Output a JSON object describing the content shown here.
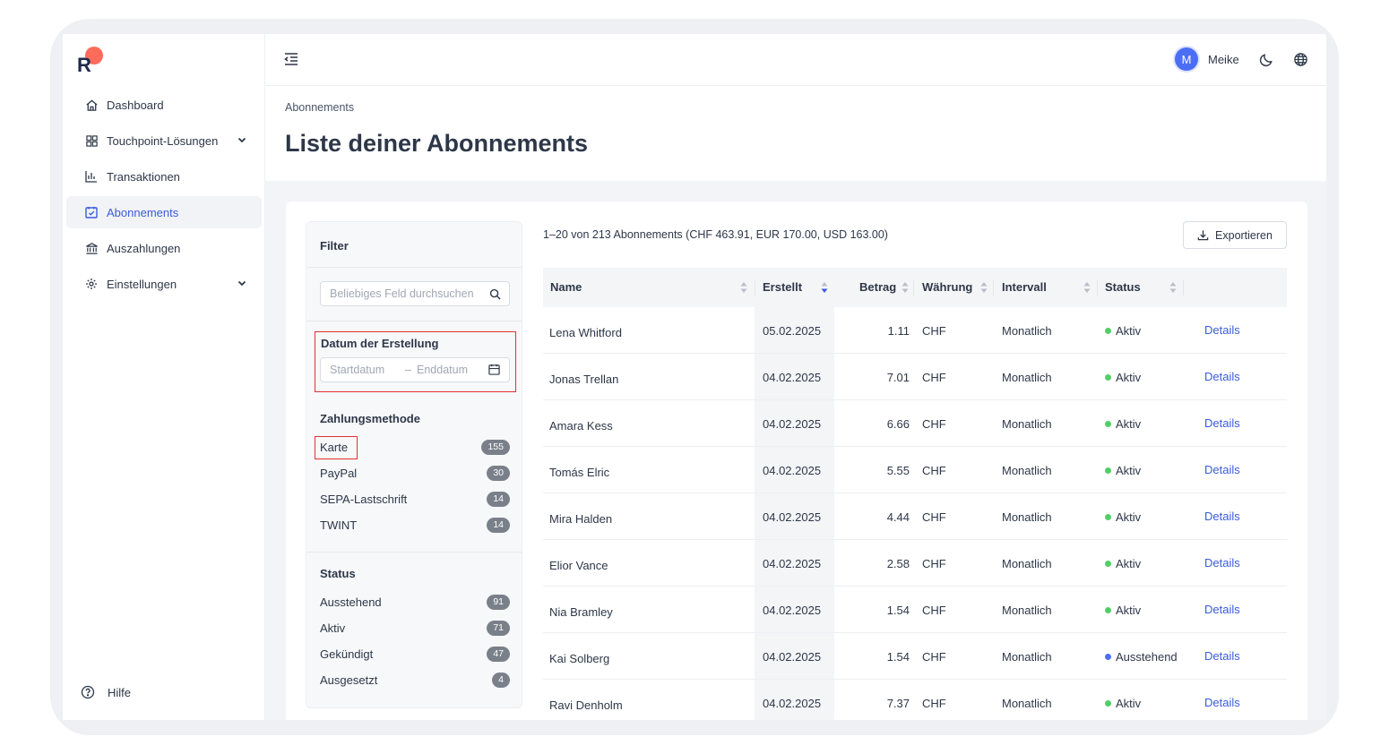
{
  "sidebar": {
    "items": [
      {
        "label": "Dashboard",
        "icon": "home-icon"
      },
      {
        "label": "Touchpoint-Lösungen",
        "icon": "grid-icon"
      },
      {
        "label": "Transaktionen",
        "icon": "bar-chart-icon"
      },
      {
        "label": "Abonnements",
        "icon": "calendar-check-icon"
      },
      {
        "label": "Auszahlungen",
        "icon": "bank-icon"
      },
      {
        "label": "Einstellungen",
        "icon": "gear-icon"
      }
    ],
    "help_label": "Hilfe"
  },
  "topbar": {
    "avatar_initial": "M",
    "user_name": "Meike"
  },
  "page": {
    "breadcrumb": "Abonnements",
    "title": "Liste deiner Abonnements"
  },
  "filter": {
    "title": "Filter",
    "search_placeholder": "Beliebiges Feld durchsuchen",
    "date_label": "Datum der Erstellung",
    "date_start_placeholder": "Startdatum",
    "date_separator": "–",
    "date_end_placeholder": "Enddatum",
    "payment_title": "Zahlungsmethode",
    "payment_methods": [
      {
        "label": "Karte",
        "count": "155"
      },
      {
        "label": "PayPal",
        "count": "30"
      },
      {
        "label": "SEPA-Lastschrift",
        "count": "14"
      },
      {
        "label": "TWINT",
        "count": "14"
      }
    ],
    "status_title": "Status",
    "statuses": [
      {
        "label": "Ausstehend",
        "count": "91"
      },
      {
        "label": "Aktiv",
        "count": "71"
      },
      {
        "label": "Gekündigt",
        "count": "47"
      },
      {
        "label": "Ausgesetzt",
        "count": "4"
      }
    ]
  },
  "summary": "1–20 von 213 Abonnements (CHF 463.91, EUR 170.00, USD 163.00)",
  "export_label": "Exportieren",
  "table": {
    "headers": {
      "name": "Name",
      "created": "Erstellt",
      "amount": "Betrag",
      "currency": "Währung",
      "interval": "Intervall",
      "status": "Status"
    },
    "rows": [
      {
        "name": "Lena Whitford",
        "created": "05.02.2025",
        "amount": "1.11",
        "currency": "CHF",
        "interval": "Monatlich",
        "status": "Aktiv",
        "link": "Details"
      },
      {
        "name": "Jonas Trellan",
        "created": "04.02.2025",
        "amount": "7.01",
        "currency": "CHF",
        "interval": "Monatlich",
        "status": "Aktiv",
        "link": "Details"
      },
      {
        "name": "Amara Kess",
        "created": "04.02.2025",
        "amount": "6.66",
        "currency": "CHF",
        "interval": "Monatlich",
        "status": "Aktiv",
        "link": "Details"
      },
      {
        "name": "Tomás Elric",
        "created": "04.02.2025",
        "amount": "5.55",
        "currency": "CHF",
        "interval": "Monatlich",
        "status": "Aktiv",
        "link": "Details"
      },
      {
        "name": "Mira Halden",
        "created": "04.02.2025",
        "amount": "4.44",
        "currency": "CHF",
        "interval": "Monatlich",
        "status": "Aktiv",
        "link": "Details"
      },
      {
        "name": "Elior Vance",
        "created": "04.02.2025",
        "amount": "2.58",
        "currency": "CHF",
        "interval": "Monatlich",
        "status": "Aktiv",
        "link": "Details"
      },
      {
        "name": "Nia Bramley",
        "created": "04.02.2025",
        "amount": "1.54",
        "currency": "CHF",
        "interval": "Monatlich",
        "status": "Aktiv",
        "link": "Details"
      },
      {
        "name": "Kai Solberg",
        "created": "04.02.2025",
        "amount": "1.54",
        "currency": "CHF",
        "interval": "Monatlich",
        "status": "Ausstehend",
        "link": "Details"
      },
      {
        "name": "Ravi Denholm",
        "created": "04.02.2025",
        "amount": "7.37",
        "currency": "CHF",
        "interval": "Monatlich",
        "status": "Aktiv",
        "link": "Details"
      }
    ]
  },
  "colors": {
    "accent": "#3b5bdb",
    "active_status": "#51cf66",
    "pending_status": "#4c6ef5",
    "highlight_border": "#e03131"
  }
}
